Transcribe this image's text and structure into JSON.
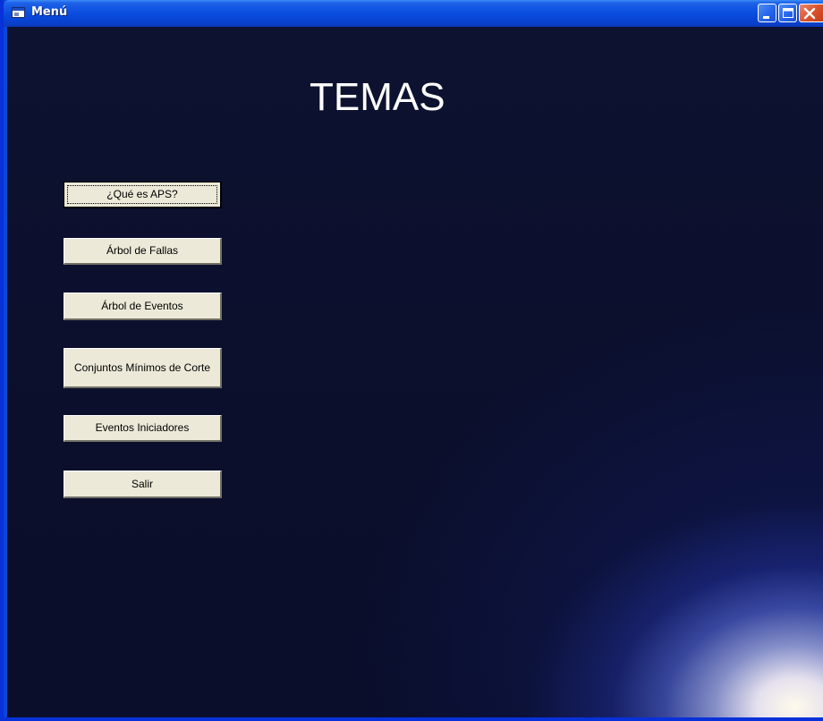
{
  "window": {
    "title": "Menú",
    "icon": "form-icon",
    "controls": [
      "minimize-icon",
      "maximize-icon",
      "close-icon"
    ]
  },
  "main": {
    "heading": "TEMAS",
    "buttons": [
      {
        "label": "¿Qué es APS?",
        "focused": true
      },
      {
        "label": "Árbol de Fallas"
      },
      {
        "label": "Árbol de Eventos"
      },
      {
        "label": "Conjuntos Mínimos de Corte"
      },
      {
        "label": "Eventos Iniciadores"
      },
      {
        "label": "Salir"
      }
    ]
  },
  "colors": {
    "titlebar": "#0a4fe0",
    "client_background": "#0b0f2c",
    "button_face": "#ece9d8",
    "close_button": "#d9502b"
  }
}
